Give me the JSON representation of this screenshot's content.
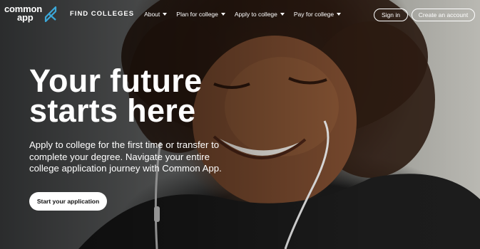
{
  "brand": {
    "line1": "common",
    "line2": "app"
  },
  "nav": {
    "find": "FIND COLLEGES",
    "items": [
      {
        "label": "About"
      },
      {
        "label": "Plan for college"
      },
      {
        "label": "Apply to college"
      },
      {
        "label": "Pay for college"
      }
    ],
    "sign_in": "Sign in",
    "create_account": "Create an account"
  },
  "hero": {
    "headline_line1": "Your future",
    "headline_line2": "starts here",
    "subtext": "Apply to college for the first time or transfer to complete your degree. Navigate your entire college application journey with Common App.",
    "cta": "Start your application"
  },
  "colors": {
    "accent": "#3ba7d8",
    "text": "#ffffff"
  }
}
